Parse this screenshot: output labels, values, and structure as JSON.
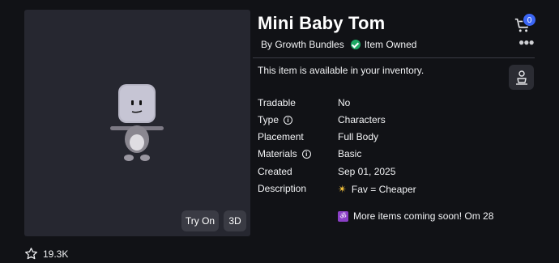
{
  "item": {
    "title": "Mini Baby Tom",
    "creator": "By Growth Bundles",
    "owned_label": "Item Owned",
    "availability": "This item is available in your inventory."
  },
  "preview": {
    "try_on_label": "Try On",
    "view_3d_label": "3D"
  },
  "favorites": {
    "count": "19.3K"
  },
  "cart": {
    "count": "0"
  },
  "details": [
    {
      "label": "Tradable",
      "value": "No"
    },
    {
      "label": "Type",
      "value": "Characters"
    },
    {
      "label": "Placement",
      "value": "Full Body"
    },
    {
      "label": "Materials",
      "value": "Basic"
    },
    {
      "label": "Created",
      "value": "Sep 01, 2025"
    },
    {
      "label": "Description",
      "value": "Fav = Cheaper"
    }
  ],
  "description_extra": "More items coming soon! Om 28",
  "icons": {
    "star": "star-icon",
    "cart": "cart-icon",
    "more": "more-icon",
    "avatar": "avatar-icon",
    "info": "info-icon",
    "owned": "check-circle-icon",
    "sparkle": "sparkle-icon",
    "om": "om-icon"
  },
  "colors": {
    "background": "#111216",
    "panel": "#262730",
    "owned_green": "#1ea863",
    "badge_blue": "#3b66f5"
  }
}
